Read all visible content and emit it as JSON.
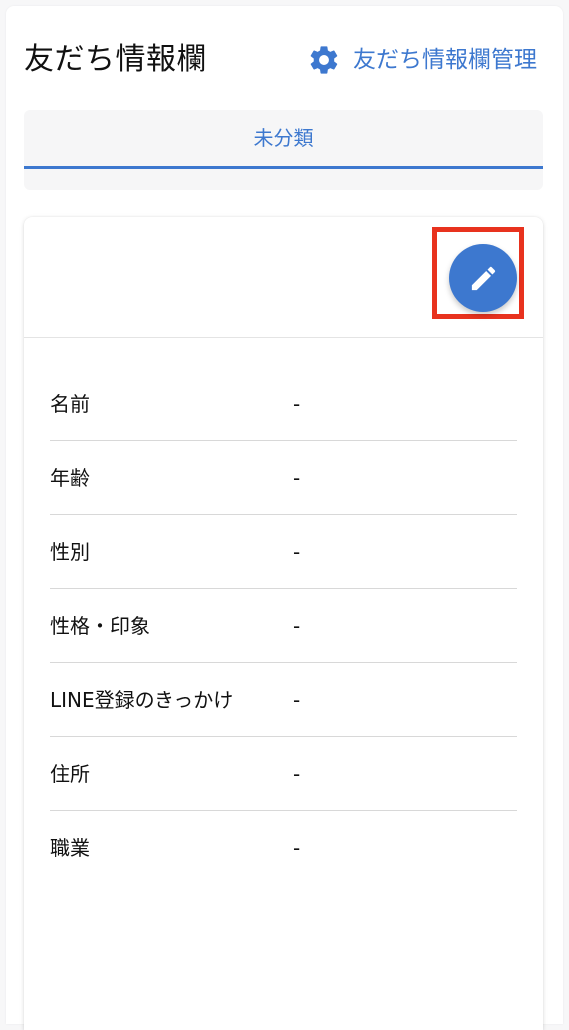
{
  "header": {
    "title": "友だち情報欄",
    "manage_link": {
      "icon": "gear-icon",
      "label": "友だち情報欄管理"
    }
  },
  "tabs": [
    {
      "label": "未分類",
      "active": true
    }
  ],
  "card": {
    "edit_button_icon": "pencil-icon",
    "fields": [
      {
        "label": "名前",
        "value": "-"
      },
      {
        "label": "年齢",
        "value": "-"
      },
      {
        "label": "性別",
        "value": "-"
      },
      {
        "label": "性格・印象",
        "value": "-"
      },
      {
        "label": "LINE登録のきっかけ",
        "value": "-"
      },
      {
        "label": "住所",
        "value": "-"
      },
      {
        "label": "職業",
        "value": "-"
      }
    ]
  },
  "colors": {
    "accent": "#3d78cf",
    "highlight": "#e8321e",
    "text": "#111111",
    "divider": "#d8d8d8"
  }
}
